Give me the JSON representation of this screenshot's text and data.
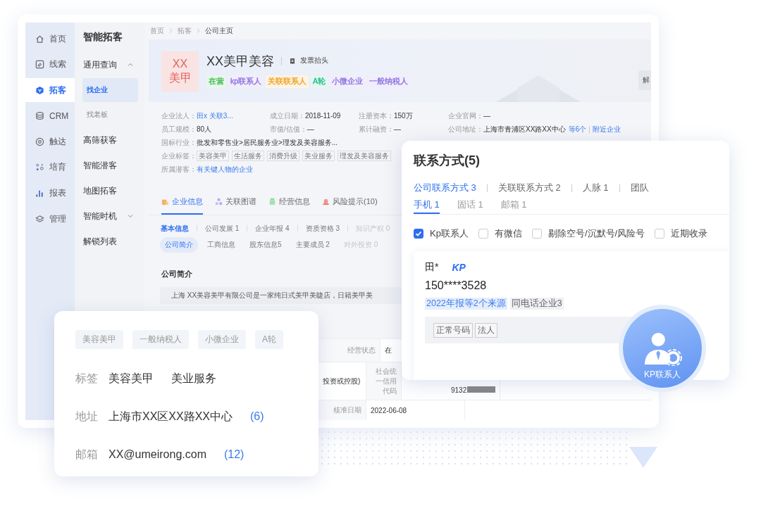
{
  "nav": [
    {
      "label": "首页",
      "kind": "home",
      "selected": false
    },
    {
      "label": "线索",
      "kind": "clue",
      "selected": false
    },
    {
      "label": "拓客",
      "kind": "target",
      "selected": true
    },
    {
      "label": "CRM",
      "kind": "crm",
      "selected": false
    },
    {
      "label": "触达",
      "kind": "reach",
      "selected": false
    },
    {
      "label": "培育",
      "kind": "nurture",
      "selected": false
    },
    {
      "label": "报表",
      "kind": "report",
      "selected": false
    },
    {
      "label": "管理",
      "kind": "manage",
      "selected": false
    }
  ],
  "subnav": {
    "title": "智能拓客",
    "items": [
      {
        "label": "通用查询",
        "selected": false,
        "expanded": true,
        "children": [
          {
            "label": "找企业",
            "selected": true
          },
          {
            "label": "找老板",
            "selected": false
          }
        ]
      },
      {
        "label": "高筛获客",
        "selected": false
      },
      {
        "label": "智能潜客",
        "selected": false
      },
      {
        "label": "地图拓客",
        "selected": false
      },
      {
        "label": "智能时机",
        "selected": false,
        "expanded": false
      },
      {
        "label": "解锁列表",
        "selected": false
      }
    ]
  },
  "breadcrumb": [
    "首页",
    "拓客",
    "公司主页"
  ],
  "company": {
    "logo_lines": [
      "XX",
      "美甲"
    ],
    "name": "XX美甲美容",
    "invoice": "发票抬头",
    "action": "解",
    "tags": [
      {
        "label": "在营",
        "color": "#3fb950"
      },
      {
        "label": "kp联系人",
        "color": "#8b6fe0"
      },
      {
        "label": "关联联系人",
        "color": "#f0a020"
      },
      {
        "label": "A轮",
        "color": "#22b98a"
      },
      {
        "label": "小微企业",
        "color": "#8b6fe0"
      },
      {
        "label": "一般纳税人",
        "color": "#8b6fe0"
      }
    ],
    "info": [
      [
        {
          "label": "企业法人：",
          "value": "田x 关联3...",
          "link": true
        },
        {
          "label": "成立日期：",
          "value": "2018-11-09"
        },
        {
          "label": "注册资本：",
          "value": "150万"
        },
        {
          "label": "企业官网：",
          "value": "—"
        }
      ],
      [
        {
          "label": "员工规模：",
          "value": "80人"
        },
        {
          "label": "市值/估值：",
          "value": "—"
        },
        {
          "label": "累计融资：",
          "value": "—"
        },
        {
          "label": "公司地址：",
          "value": "上海市青浦区XX路XX中心",
          "links": [
            "等6个",
            "附近企业"
          ]
        }
      ],
      [
        {
          "label": "国标行业：",
          "value": "批发和零售业>居民服务业>理发及美容服务..."
        }
      ],
      [
        {
          "label": "企业标签：",
          "tags": [
            "美容美甲",
            "生活服务",
            "消费升级",
            "美业服务",
            "理发及美容服务"
          ]
        }
      ],
      [
        {
          "label": "所属潜客：",
          "value": "有关键人物的企业",
          "link": true
        }
      ]
    ]
  },
  "tabs": [
    {
      "label": "企业信息",
      "kind": "building",
      "selected": true
    },
    {
      "label": "关联图谱",
      "kind": "graph",
      "selected": false
    },
    {
      "label": "经营信息",
      "kind": "money",
      "selected": false
    },
    {
      "label": "风险提示(10)",
      "kind": "risk",
      "selected": false
    }
  ],
  "subtabs": [
    {
      "label": "基本信息",
      "selected": true,
      "disabled": false
    },
    {
      "label": "公司发展 1",
      "selected": false,
      "disabled": false
    },
    {
      "label": "企业年报 4",
      "selected": false,
      "disabled": false
    },
    {
      "label": "资质资格 3",
      "selected": false,
      "disabled": false
    },
    {
      "label": "知识产权 0",
      "selected": false,
      "disabled": true
    }
  ],
  "pills": [
    {
      "label": "公司简介",
      "selected": true,
      "disabled": false
    },
    {
      "label": "工商信息",
      "selected": false,
      "disabled": false
    },
    {
      "label": "股东信息5",
      "selected": false,
      "disabled": false
    },
    {
      "label": "主要成员 2",
      "selected": false,
      "disabled": false
    },
    {
      "label": "对外投资 0",
      "selected": false,
      "disabled": true
    }
  ],
  "intro": {
    "heading": "公司简介",
    "text": "上海 XX美容美甲有限公司是一家纯日式美甲美睫店，日籍美甲美"
  },
  "table": {
    "rows": [
      [
        {
          "text": "经营状态",
          "kind": "label"
        },
        {
          "text": "在",
          "kind": "value"
        }
      ],
      [
        {
          "text": "投资或控股)",
          "kind": "value"
        },
        {
          "text": "社会统一信用代码",
          "kind": "label"
        },
        {
          "text": "9132",
          "kind": "redacted"
        }
      ],
      [
        {
          "text": "核准日期",
          "kind": "label"
        },
        {
          "text": "2022-06-08",
          "kind": "value"
        }
      ]
    ]
  },
  "profile_card": {
    "tags": [
      "美容美甲",
      "一般纳税人",
      "小微企业",
      "A轮"
    ],
    "rows": [
      {
        "label": "标签",
        "values": [
          "美容美甲",
          "美业服务"
        ]
      },
      {
        "label": "地址",
        "values": [
          "上海市XX区XX路XX中心"
        ],
        "count": "(6)"
      },
      {
        "label": "邮箱",
        "values": [
          "XX@umeirong.com"
        ],
        "count": "(12)"
      }
    ]
  },
  "contact_card": {
    "title": "联系方式(5)",
    "tabs": [
      {
        "label": "公司联系方式 3",
        "selected": true
      },
      {
        "label": "关联联系方式 2",
        "selected": false
      },
      {
        "label": "人脉 1",
        "selected": false
      },
      {
        "label": "团队",
        "selected": false
      }
    ],
    "subtabs": [
      {
        "label": "手机 1",
        "selected": true
      },
      {
        "label": "固话 1",
        "selected": false
      },
      {
        "label": "邮箱 1",
        "selected": false
      }
    ],
    "filters": [
      {
        "label": "Kp联系人",
        "checked": true
      },
      {
        "label": "有微信",
        "checked": false
      },
      {
        "label": "剔除空号/沉默号/风险号",
        "checked": false
      },
      {
        "label": "近期收录",
        "checked": false
      }
    ],
    "contact": {
      "name": "田*",
      "badge": "KP",
      "phone": "150****3528",
      "source": "2022年报等2个来源",
      "same": "同电话企业3",
      "tags": [
        "正常号码",
        "法人"
      ]
    }
  },
  "kp_badge": {
    "label": "KP联系人"
  }
}
